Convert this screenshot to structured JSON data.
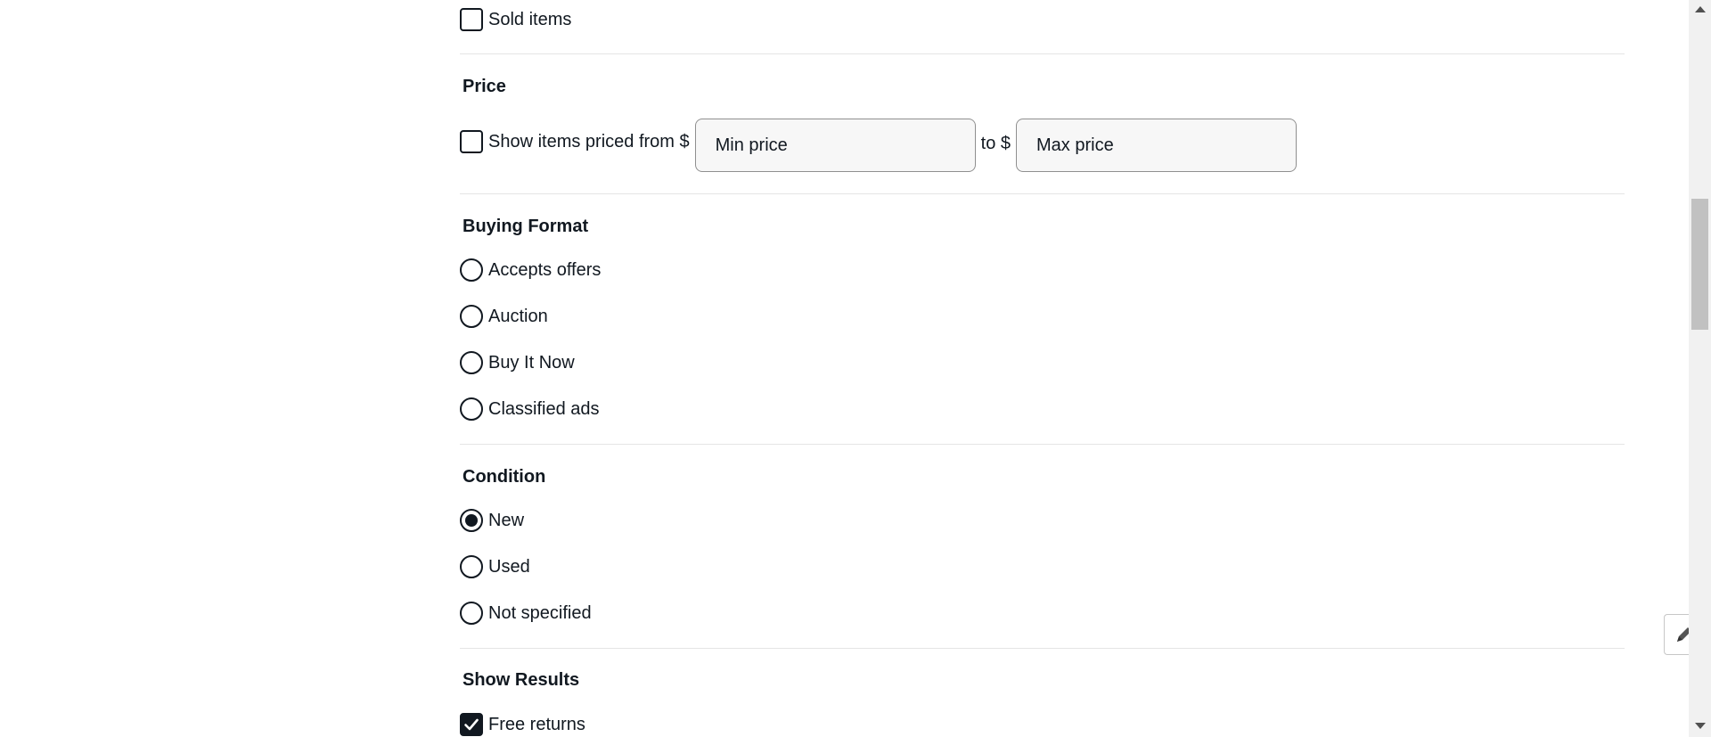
{
  "filters": {
    "sold_items": {
      "label": "Sold items",
      "checked": false
    },
    "price": {
      "title": "Price",
      "show_items_label": "Show items priced from $",
      "min_placeholder": "Min price",
      "to_label": "to $",
      "max_placeholder": "Max price",
      "checked": false
    },
    "buying_format": {
      "title": "Buying Format",
      "options": [
        {
          "label": "Accepts offers",
          "selected": false
        },
        {
          "label": "Auction",
          "selected": false
        },
        {
          "label": "Buy It Now",
          "selected": false
        },
        {
          "label": "Classified ads",
          "selected": false
        }
      ]
    },
    "condition": {
      "title": "Condition",
      "options": [
        {
          "label": "New",
          "selected": true
        },
        {
          "label": "Used",
          "selected": false
        },
        {
          "label": "Not specified",
          "selected": false
        }
      ]
    },
    "show_results": {
      "title": "Show Results",
      "options": [
        {
          "label": "Free returns",
          "checked": true
        }
      ]
    }
  },
  "icons": {
    "checkmark": "check-icon",
    "feedback": "pencil-icon"
  },
  "colors": {
    "text": "#111820",
    "divider": "#e5e5e5",
    "input_bg": "#f7f7f7"
  }
}
